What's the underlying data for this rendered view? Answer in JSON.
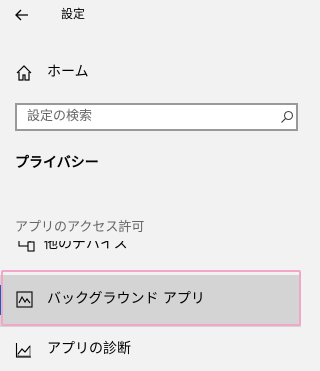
{
  "header": {
    "title": "設定",
    "back_icon": "back-arrow-icon"
  },
  "nav": {
    "home_label": "ホーム",
    "home_icon": "home-icon"
  },
  "search": {
    "placeholder": "設定の検索",
    "icon": "search-icon"
  },
  "section": {
    "title": "プライバシー"
  },
  "group": {
    "header": "アプリのアクセス許可"
  },
  "items": [
    {
      "label": "他のデバイス",
      "icon": "devices-icon",
      "partially_visible": true
    },
    {
      "label": "バックグラウンド アプリ",
      "icon": "background-apps-icon",
      "selected": true
    },
    {
      "label": "アプリの診断",
      "icon": "app-diagnostics-icon"
    }
  ],
  "colors": {
    "background": "#f2f2f2",
    "selected_bg": "#d4d4d4",
    "highlight_outline": "#f3a7c6",
    "accent": "#0a66c2"
  }
}
